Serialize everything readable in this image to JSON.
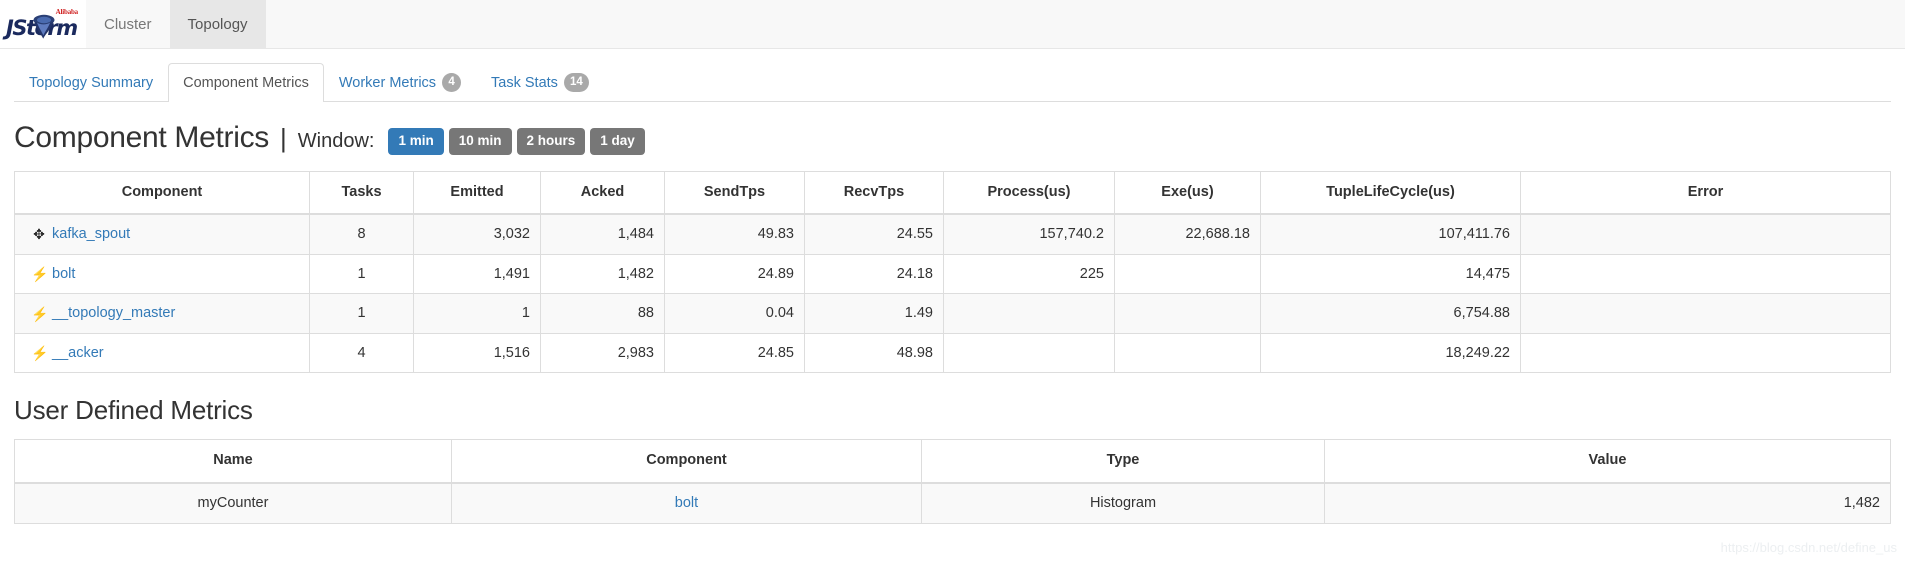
{
  "navbar": {
    "brand": {
      "name": "JStorm",
      "sub": "Alibaba",
      "icon": "storm-funnel-icon"
    },
    "items": [
      {
        "label": "Cluster",
        "active": false
      },
      {
        "label": "Topology",
        "active": true
      }
    ]
  },
  "subtabs": [
    {
      "label": "Topology Summary",
      "badge": "",
      "active": false
    },
    {
      "label": "Component Metrics",
      "badge": "",
      "active": true
    },
    {
      "label": "Worker Metrics",
      "badge": "4",
      "active": false
    },
    {
      "label": "Task Stats",
      "badge": "14",
      "active": false
    }
  ],
  "page": {
    "title": "Component Metrics",
    "separator": "|",
    "window_label": "Window:",
    "window_buttons": [
      {
        "label": "1 min",
        "active": true
      },
      {
        "label": "10 min",
        "active": false
      },
      {
        "label": "2 hours",
        "active": false
      },
      {
        "label": "1 day",
        "active": false
      }
    ]
  },
  "component_metrics": {
    "columns": [
      "Component",
      "Tasks",
      "Emitted",
      "Acked",
      "SendTps",
      "RecvTps",
      "Process(us)",
      "Exe(us)",
      "TupleLifeCycle(us)",
      "Error"
    ],
    "rows": [
      {
        "icon": "shuffle-icon",
        "component": "kafka_spout",
        "tasks": "8",
        "emitted": "3,032",
        "acked": "1,484",
        "send_tps": "49.83",
        "recv_tps": "24.55",
        "process_us": "157,740.2",
        "exe_us": "22,688.18",
        "tuple_life_cycle_us": "107,411.76",
        "error": ""
      },
      {
        "icon": "bolt-icon",
        "component": "bolt",
        "tasks": "1",
        "emitted": "1,491",
        "acked": "1,482",
        "send_tps": "24.89",
        "recv_tps": "24.18",
        "process_us": "225",
        "exe_us": "",
        "tuple_life_cycle_us": "14,475",
        "error": ""
      },
      {
        "icon": "bolt-icon",
        "component": "__topology_master",
        "tasks": "1",
        "emitted": "1",
        "acked": "88",
        "send_tps": "0.04",
        "recv_tps": "1.49",
        "process_us": "",
        "exe_us": "",
        "tuple_life_cycle_us": "6,754.88",
        "error": ""
      },
      {
        "icon": "bolt-icon",
        "component": "__acker",
        "tasks": "4",
        "emitted": "1,516",
        "acked": "2,983",
        "send_tps": "24.85",
        "recv_tps": "48.98",
        "process_us": "",
        "exe_us": "",
        "tuple_life_cycle_us": "18,249.22",
        "error": ""
      }
    ]
  },
  "user_defined_metrics": {
    "title": "User Defined Metrics",
    "columns": [
      "Name",
      "Component",
      "Type",
      "Value"
    ],
    "rows": [
      {
        "name": "myCounter",
        "component": "bolt",
        "type": "Histogram",
        "value": "1,482"
      }
    ]
  },
  "watermark": "https://blog.csdn.net/define_us",
  "colors": {
    "accent": "#337ab7",
    "muted_button": "#777777",
    "navbar_bg": "#f8f8f8",
    "active_tab_bg": "#e7e7e7",
    "badge_bg": "#a9a9a9",
    "border": "#dddddd",
    "brand_red": "#cf2222",
    "brand_navy": "#1b2a5e"
  }
}
